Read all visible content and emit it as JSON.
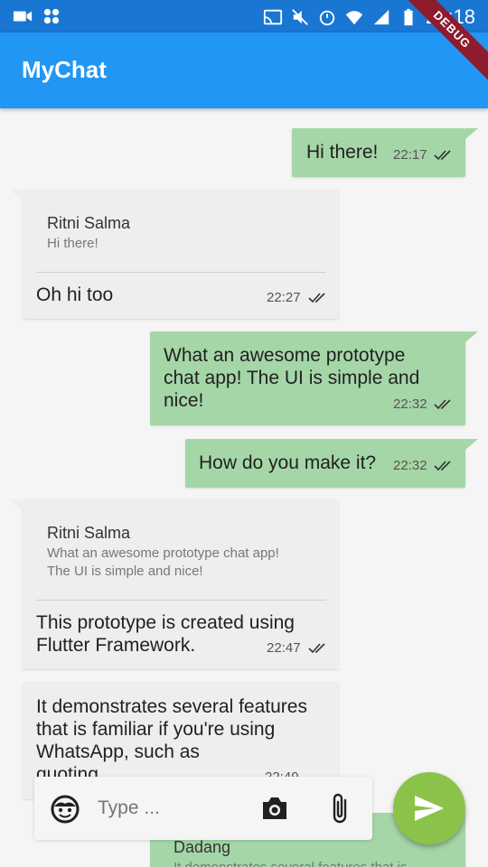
{
  "status_bar": {
    "time": "22:18",
    "left_icons": [
      "video-camera-icon",
      "apps-icon"
    ],
    "right_icons": [
      "cast-icon",
      "mute-icon",
      "alarm-icon",
      "wifi-icon",
      "signal-icon",
      "battery-icon"
    ]
  },
  "app_bar": {
    "title": "MyChat"
  },
  "debug_banner": "DEBUG",
  "messages": [
    {
      "dir": "out",
      "text": "Hi there!",
      "time": "22:17"
    },
    {
      "dir": "in",
      "quote_name": "Ritni Salma",
      "quote_text": "Hi there!",
      "text": "Oh hi too",
      "time": "22:27"
    },
    {
      "dir": "out",
      "text_lines": [
        "What an awesome prototype",
        "chat app! The UI is simple and",
        "nice!"
      ],
      "time": "22:32"
    },
    {
      "dir": "out",
      "text": "How do you make it?",
      "time": "22:32"
    },
    {
      "dir": "in",
      "quote_name": "Ritni Salma",
      "quote_text_lines": [
        "What an awesome prototype chat app!",
        "The UI is simple and nice!"
      ],
      "text_lines": [
        "This prototype is created using",
        "Flutter Framework."
      ],
      "time": "22:47"
    },
    {
      "dir": "in",
      "text_lines": [
        "It demonstrates several features",
        "that is familiar if you're using",
        "WhatsApp, such as",
        "quoting..."
      ],
      "time": "22:49"
    },
    {
      "dir": "out",
      "quote_name": "Dadang",
      "quote_text": "It demonstrates several features that is"
    }
  ],
  "input": {
    "placeholder": "Type ..."
  },
  "colors": {
    "app_bar": "#2196f3",
    "status_bar": "#1976d2",
    "outgoing": "#a5d6a7",
    "incoming": "#eeeeee",
    "send_button": "#8bc34a"
  }
}
